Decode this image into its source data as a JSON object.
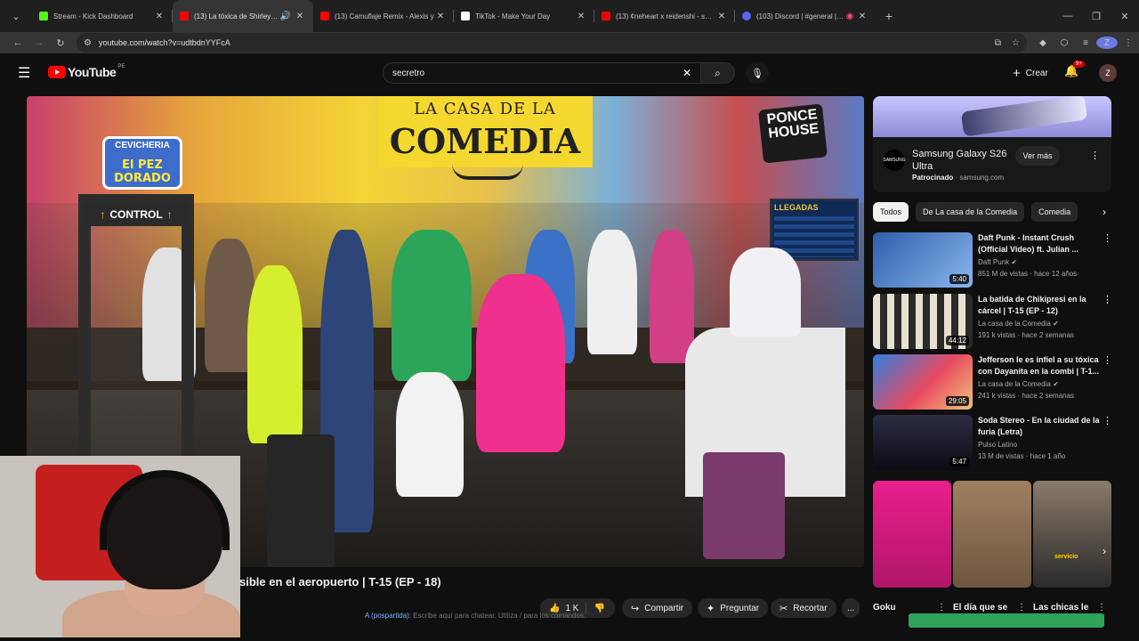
{
  "browser": {
    "tabs": [
      {
        "title": "Stream - Kick Dashboard",
        "color": "#53fc18",
        "active": false
      },
      {
        "title": "(13) La tóxica de Shirley le h",
        "color": "#ff0000",
        "active": true
      },
      {
        "title": "(13) Camuflaje Remix - Alexis y",
        "color": "#ff0000",
        "active": false
      },
      {
        "title": "TikTok - Make Your Day",
        "color": "#ffffff",
        "active": false
      },
      {
        "title": "(13) ¢neheart x reidenshi - snow",
        "color": "#ff0000",
        "active": false
      },
      {
        "title": "(103) Discord | #general | Lo",
        "color": "#5865f2",
        "active": false
      }
    ],
    "url": "youtube.com/watch?v=udtbdnYYFcA",
    "profile_initial": "Z"
  },
  "header": {
    "logo_text": "YouTube",
    "logo_region": "PE",
    "search_value": "secretro",
    "create_label": "Crear",
    "notification_count": "9+",
    "avatar_initial": "Z"
  },
  "video": {
    "mural_line1": "LA CASA DE LA",
    "mural_line2": "COMEDIA",
    "cevicheria_title": "CEVICHERIA",
    "cevicheria_name": "El PEZ DORADO",
    "ponce_sign": "PONCE HOUSE",
    "control_sign": "CONTROL",
    "llegadas_sign": "LLEGADAS",
    "title_visible": "sible en el aeropuerto | T-15 (EP - 18)"
  },
  "actions": {
    "likes": "1 K",
    "share": "Compartir",
    "ask": "Preguntar",
    "clip": "Recortar",
    "more": "..."
  },
  "chat": {
    "user": "A (pospartida):",
    "placeholder": "Escribe aquí para chatear. Utiliza / para los comandos."
  },
  "ad": {
    "title": "Samsung Galaxy S26 Ultra",
    "sponsored": "Patrocinado",
    "domain": "samsung.com",
    "cta": "Ver más",
    "brand": "SAMSUNG"
  },
  "chips": [
    "Todos",
    "De La casa de la Comedia",
    "Comedia"
  ],
  "recommendations": [
    {
      "title": "Daft Punk - Instant Crush (Official Video) ft. Julian ...",
      "channel": "Daft Punk",
      "meta": "851 M de vistas · hace 12 años",
      "duration": "5:40",
      "thumb": "#3a7bd5"
    },
    {
      "title": "La batida de Chikipresi en la cárcel | T-15 (EP - 12)",
      "channel": "La casa de la Comedia",
      "meta": "191 k vistas · hace 2 semanas",
      "duration": "44:12",
      "thumb": "#d9c7a5"
    },
    {
      "title": "Jefferson le es infiel a su tóxica con Dayanita en la combi | T-1...",
      "channel": "La casa de la Comedia",
      "meta": "241 k vistas · hace 2 semanas",
      "duration": "29:05",
      "thumb": "#4a90d9"
    },
    {
      "title": "Soda Stereo - En la ciudad de la furia (Letra)",
      "channel": "Pulso Latino",
      "meta": "13 M de vistas · hace 1 año",
      "duration": "5:47",
      "thumb": "#1b1b2a"
    }
  ],
  "shorts": [
    {
      "title": "Goku",
      "color": "#d81b7a"
    },
    {
      "title": "El día que se",
      "color": "#8a6d55"
    },
    {
      "title": "Las chicas le",
      "color": "#3a3a3a"
    }
  ],
  "shorts_badge": "servicio"
}
